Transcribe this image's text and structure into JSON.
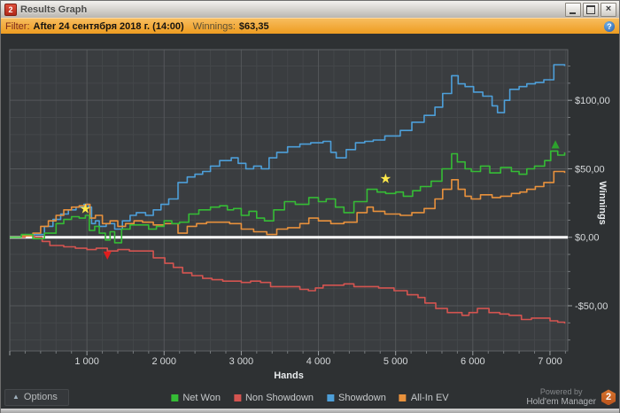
{
  "window": {
    "title": "Results Graph",
    "icon_text": "2",
    "close_glyph": "×"
  },
  "filter_bar": {
    "label": "Filter:",
    "value": "After 24 сентября 2018 г. (14:00)",
    "winnings_label": "Winnings:",
    "winnings_value": "$63,35",
    "help_glyph": "?"
  },
  "footer": {
    "options_label": "Options",
    "options_arrow": "▲",
    "powered_line1": "Powered by",
    "powered_line2": "Hold'em Manager",
    "logo_text": "2"
  },
  "colors": {
    "net_won": "#35bc35",
    "non_showdown": "#d45450",
    "showdown": "#4d9fd9",
    "all_in_ev": "#e8913c",
    "zero_line": "#ffffff",
    "filter_bar": "#ee9c20"
  },
  "chart_data": {
    "type": "line",
    "title": "",
    "xlabel": "Hands",
    "ylabel": "Winnings",
    "xlim": [
      0,
      7230
    ],
    "ylim": [
      -83,
      137
    ],
    "x_minor_step": 200,
    "y_minor_step": 12.5,
    "grid": true,
    "legend_position": "bottom",
    "x_ticks": [
      {
        "v": 1000,
        "label": "1 000"
      },
      {
        "v": 2000,
        "label": "2 000"
      },
      {
        "v": 3000,
        "label": "3 000"
      },
      {
        "v": 4000,
        "label": "4 000"
      },
      {
        "v": 5000,
        "label": "5 000"
      },
      {
        "v": 6000,
        "label": "6 000"
      },
      {
        "v": 7000,
        "label": "7 000"
      }
    ],
    "y_ticks": [
      {
        "v": 100,
        "label": "$100,00"
      },
      {
        "v": 50,
        "label": "$50,00"
      },
      {
        "v": 0,
        "label": "$0,00"
      },
      {
        "v": -50,
        "label": "-$50,00"
      }
    ],
    "series": [
      {
        "name": "Net Won",
        "color": "#35bc35",
        "points": [
          [
            0,
            0
          ],
          [
            150,
            2
          ],
          [
            300,
            -1
          ],
          [
            450,
            3
          ],
          [
            600,
            10
          ],
          [
            700,
            13
          ],
          [
            800,
            15
          ],
          [
            900,
            14
          ],
          [
            980,
            16
          ],
          [
            1030,
            5
          ],
          [
            1100,
            8
          ],
          [
            1160,
            3
          ],
          [
            1240,
            -2
          ],
          [
            1300,
            4
          ],
          [
            1360,
            -4
          ],
          [
            1450,
            6
          ],
          [
            1560,
            9
          ],
          [
            1700,
            9
          ],
          [
            1800,
            6
          ],
          [
            1900,
            8
          ],
          [
            2000,
            12
          ],
          [
            2100,
            10
          ],
          [
            2200,
            11
          ],
          [
            2320,
            17
          ],
          [
            2450,
            20
          ],
          [
            2600,
            22
          ],
          [
            2720,
            23
          ],
          [
            2820,
            20
          ],
          [
            2900,
            21
          ],
          [
            3000,
            16
          ],
          [
            3100,
            19
          ],
          [
            3200,
            14
          ],
          [
            3300,
            12
          ],
          [
            3420,
            20
          ],
          [
            3560,
            26
          ],
          [
            3700,
            24
          ],
          [
            3875,
            29
          ],
          [
            4000,
            26
          ],
          [
            4100,
            28
          ],
          [
            4220,
            22
          ],
          [
            4330,
            18
          ],
          [
            4460,
            26
          ],
          [
            4630,
            35
          ],
          [
            4760,
            33
          ],
          [
            4870,
            32
          ],
          [
            5000,
            33
          ],
          [
            5100,
            30
          ],
          [
            5220,
            34
          ],
          [
            5320,
            37
          ],
          [
            5460,
            41
          ],
          [
            5600,
            50
          ],
          [
            5725,
            61
          ],
          [
            5800,
            55
          ],
          [
            5900,
            50
          ],
          [
            5980,
            48
          ],
          [
            6100,
            52
          ],
          [
            6220,
            47
          ],
          [
            6360,
            51
          ],
          [
            6500,
            48
          ],
          [
            6600,
            46
          ],
          [
            6700,
            50
          ],
          [
            6800,
            52
          ],
          [
            6930,
            56
          ],
          [
            7010,
            63
          ],
          [
            7100,
            60
          ],
          [
            7190,
            62
          ]
        ]
      },
      {
        "name": "Non Showdown",
        "color": "#d45450",
        "points": [
          [
            0,
            0
          ],
          [
            200,
            1
          ],
          [
            320,
            0
          ],
          [
            420,
            -3
          ],
          [
            520,
            -6
          ],
          [
            700,
            -7
          ],
          [
            850,
            -8
          ],
          [
            1000,
            -9
          ],
          [
            1120,
            -8
          ],
          [
            1265,
            -10
          ],
          [
            1400,
            -9
          ],
          [
            1550,
            -10
          ],
          [
            1720,
            -10
          ],
          [
            1860,
            -15
          ],
          [
            2010,
            -19
          ],
          [
            2120,
            -22
          ],
          [
            2240,
            -26
          ],
          [
            2360,
            -28
          ],
          [
            2500,
            -30
          ],
          [
            2620,
            -31
          ],
          [
            2760,
            -32
          ],
          [
            2880,
            -32
          ],
          [
            3000,
            -33
          ],
          [
            3120,
            -32
          ],
          [
            3250,
            -33
          ],
          [
            3380,
            -36
          ],
          [
            3520,
            -36
          ],
          [
            3640,
            -36
          ],
          [
            3760,
            -38
          ],
          [
            3870,
            -39
          ],
          [
            3960,
            -37
          ],
          [
            4060,
            -35
          ],
          [
            4200,
            -35
          ],
          [
            4330,
            -34
          ],
          [
            4460,
            -36
          ],
          [
            4600,
            -36
          ],
          [
            4780,
            -37
          ],
          [
            4980,
            -39
          ],
          [
            5150,
            -42
          ],
          [
            5290,
            -44
          ],
          [
            5380,
            -48
          ],
          [
            5520,
            -52
          ],
          [
            5670,
            -55
          ],
          [
            5860,
            -57
          ],
          [
            5950,
            -55
          ],
          [
            6060,
            -52
          ],
          [
            6210,
            -55
          ],
          [
            6350,
            -56
          ],
          [
            6470,
            -57
          ],
          [
            6630,
            -60
          ],
          [
            6760,
            -59
          ],
          [
            6900,
            -59
          ],
          [
            7000,
            -61
          ],
          [
            7100,
            -62
          ],
          [
            7190,
            -63
          ]
        ]
      },
      {
        "name": "Showdown",
        "color": "#4d9fd9",
        "points": [
          [
            0,
            0
          ],
          [
            150,
            1
          ],
          [
            300,
            2
          ],
          [
            450,
            8
          ],
          [
            560,
            13
          ],
          [
            660,
            17
          ],
          [
            760,
            20
          ],
          [
            860,
            22
          ],
          [
            960,
            24
          ],
          [
            1020,
            22
          ],
          [
            1060,
            10
          ],
          [
            1110,
            12
          ],
          [
            1160,
            8
          ],
          [
            1250,
            10
          ],
          [
            1360,
            6
          ],
          [
            1460,
            12
          ],
          [
            1560,
            16
          ],
          [
            1640,
            18
          ],
          [
            1760,
            16
          ],
          [
            1860,
            20
          ],
          [
            1960,
            24
          ],
          [
            2060,
            28
          ],
          [
            2180,
            40
          ],
          [
            2300,
            44
          ],
          [
            2400,
            46
          ],
          [
            2500,
            48
          ],
          [
            2600,
            52
          ],
          [
            2720,
            56
          ],
          [
            2870,
            58
          ],
          [
            2960,
            54
          ],
          [
            3060,
            50
          ],
          [
            3160,
            52
          ],
          [
            3260,
            50
          ],
          [
            3360,
            58
          ],
          [
            3460,
            62
          ],
          [
            3600,
            66
          ],
          [
            3760,
            68
          ],
          [
            3900,
            69
          ],
          [
            4060,
            70
          ],
          [
            4160,
            62
          ],
          [
            4230,
            58
          ],
          [
            4360,
            64
          ],
          [
            4480,
            69
          ],
          [
            4600,
            70
          ],
          [
            4710,
            71
          ],
          [
            4860,
            74
          ],
          [
            5060,
            78
          ],
          [
            5210,
            84
          ],
          [
            5370,
            89
          ],
          [
            5510,
            95
          ],
          [
            5610,
            105
          ],
          [
            5725,
            118
          ],
          [
            5810,
            112
          ],
          [
            5900,
            110
          ],
          [
            6010,
            106
          ],
          [
            6130,
            103
          ],
          [
            6250,
            96
          ],
          [
            6320,
            91
          ],
          [
            6410,
            100
          ],
          [
            6480,
            108
          ],
          [
            6600,
            110
          ],
          [
            6700,
            112
          ],
          [
            6810,
            113
          ],
          [
            6920,
            115
          ],
          [
            7050,
            126
          ],
          [
            7190,
            125
          ]
        ]
      },
      {
        "name": "All-In EV",
        "color": "#e8913c",
        "points": [
          [
            0,
            0
          ],
          [
            150,
            1
          ],
          [
            300,
            3
          ],
          [
            400,
            8
          ],
          [
            500,
            12
          ],
          [
            600,
            16
          ],
          [
            700,
            20
          ],
          [
            800,
            22
          ],
          [
            900,
            23
          ],
          [
            990,
            24
          ],
          [
            1040,
            14
          ],
          [
            1110,
            16
          ],
          [
            1200,
            10
          ],
          [
            1300,
            12
          ],
          [
            1400,
            8
          ],
          [
            1500,
            10
          ],
          [
            1610,
            12
          ],
          [
            1720,
            11
          ],
          [
            1860,
            9
          ],
          [
            2000,
            10
          ],
          [
            2180,
            3
          ],
          [
            2300,
            8
          ],
          [
            2420,
            10
          ],
          [
            2550,
            11
          ],
          [
            2700,
            11
          ],
          [
            2850,
            10
          ],
          [
            3000,
            6
          ],
          [
            3160,
            4
          ],
          [
            3330,
            2
          ],
          [
            3460,
            6
          ],
          [
            3600,
            7
          ],
          [
            3760,
            10
          ],
          [
            3875,
            14
          ],
          [
            4000,
            12
          ],
          [
            4160,
            10
          ],
          [
            4330,
            11
          ],
          [
            4500,
            18
          ],
          [
            4630,
            22
          ],
          [
            4710,
            19
          ],
          [
            4860,
            17
          ],
          [
            5060,
            16
          ],
          [
            5210,
            18
          ],
          [
            5370,
            21
          ],
          [
            5510,
            28
          ],
          [
            5610,
            35
          ],
          [
            5725,
            42
          ],
          [
            5810,
            35
          ],
          [
            5900,
            30
          ],
          [
            5980,
            28
          ],
          [
            6100,
            31
          ],
          [
            6250,
            29
          ],
          [
            6360,
            30
          ],
          [
            6500,
            32
          ],
          [
            6610,
            33
          ],
          [
            6700,
            35
          ],
          [
            6810,
            37
          ],
          [
            6920,
            40
          ],
          [
            7050,
            48
          ],
          [
            7190,
            47
          ]
        ]
      }
    ],
    "markers": [
      {
        "shape": "star",
        "x": 980,
        "y": 21,
        "color": "#ffe94a"
      },
      {
        "shape": "triangle-down",
        "x": 1265,
        "y": -12,
        "color": "#e01d1d"
      },
      {
        "shape": "star",
        "x": 4870,
        "y": 43,
        "color": "#ffe94a"
      },
      {
        "shape": "triangle-up",
        "x": 7070,
        "y": 69,
        "color": "#2da12d"
      }
    ]
  }
}
